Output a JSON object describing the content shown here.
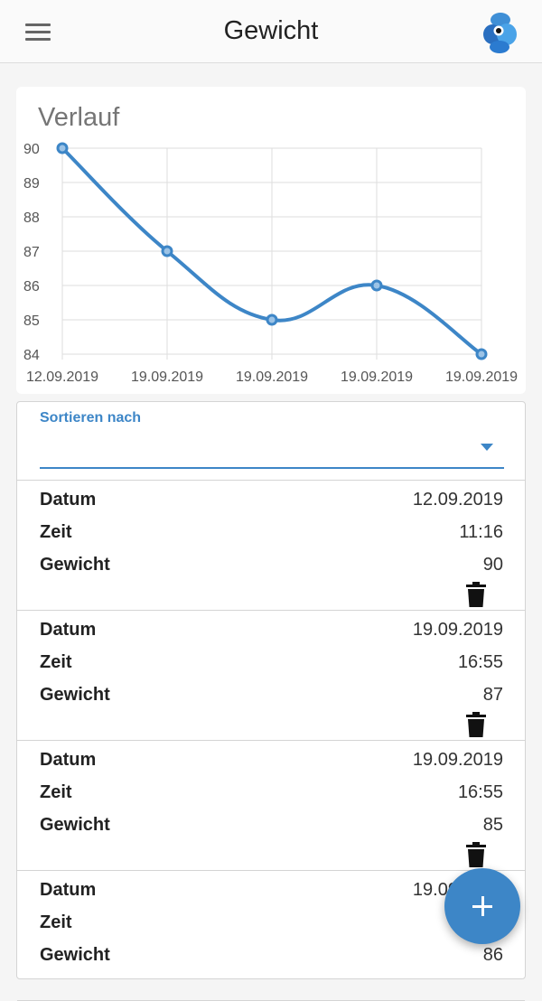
{
  "header": {
    "title": "Gewicht",
    "menu_icon": "hamburger-menu-icon",
    "logo_icon": "app-logo-icon"
  },
  "colors": {
    "accent": "#3d86c7",
    "grid": "#dddddd",
    "axis_text": "#555555"
  },
  "chart": {
    "title": "Verlauf"
  },
  "chart_data": {
    "type": "line",
    "title": "Verlauf",
    "categories": [
      "12.09.2019",
      "19.09.2019",
      "19.09.2019",
      "19.09.2019",
      "19.09.2019"
    ],
    "series": [
      {
        "values": [
          90,
          87,
          85,
          86,
          84
        ]
      }
    ],
    "y_ticks": [
      84,
      85,
      86,
      87,
      88,
      89,
      90
    ],
    "ylim": [
      84,
      90
    ],
    "grid": true,
    "xlabel": "",
    "ylabel": ""
  },
  "sort": {
    "label": "Sortieren nach",
    "value": ""
  },
  "entries": [
    {
      "date_label": "Datum",
      "date": "12.09.2019",
      "time_label": "Zeit",
      "time": "11:16",
      "weight_label": "Gewicht",
      "weight": "90"
    },
    {
      "date_label": "Datum",
      "date": "19.09.2019",
      "time_label": "Zeit",
      "time": "16:55",
      "weight_label": "Gewicht",
      "weight": "87"
    },
    {
      "date_label": "Datum",
      "date": "19.09.2019",
      "time_label": "Zeit",
      "time": "16:55",
      "weight_label": "Gewicht",
      "weight": "85"
    },
    {
      "date_label": "Datum",
      "date": "19.09.2019",
      "time_label": "Zeit",
      "time": "",
      "weight_label": "Gewicht",
      "weight": "86"
    }
  ],
  "fab": {
    "icon": "plus-icon"
  }
}
